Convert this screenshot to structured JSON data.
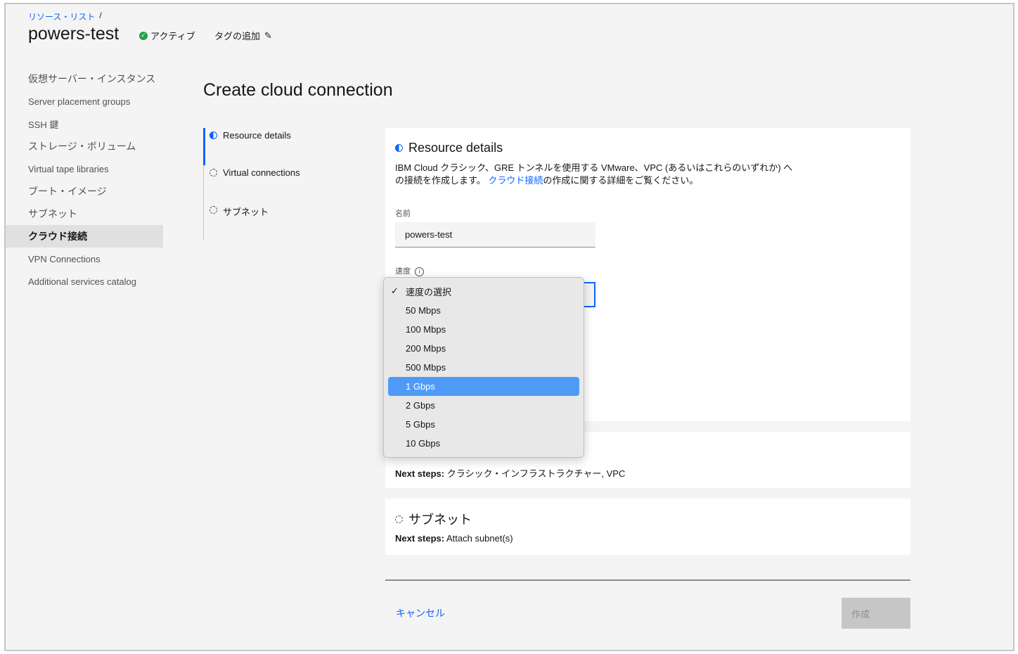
{
  "breadcrumb": {
    "link": "リソース・リスト",
    "separator": "/"
  },
  "header": {
    "title": "powers-test",
    "status": "アクティブ",
    "add_tag": "タグの追加"
  },
  "sidebar": {
    "items": [
      {
        "label": "仮想サーバー・インスタンス"
      },
      {
        "label": "Server placement groups"
      },
      {
        "label": "SSH 鍵"
      },
      {
        "label": "ストレージ・ボリューム"
      },
      {
        "label": "Virtual tape libraries"
      },
      {
        "label": "ブート・イメージ"
      },
      {
        "label": "サブネット"
      },
      {
        "label": "クラウド接続"
      },
      {
        "label": "VPN Connections"
      },
      {
        "label": "Additional services catalog"
      }
    ],
    "active_index": 7
  },
  "page": {
    "title": "Create cloud connection"
  },
  "steps": [
    {
      "label": "Resource details",
      "state": "in-progress"
    },
    {
      "label": "Virtual connections",
      "state": "not-started"
    },
    {
      "label": "サブネット",
      "state": "not-started"
    }
  ],
  "resource_details": {
    "title": "Resource details",
    "description_part1": "IBM Cloud クラシック、GRE トンネルを使用する VMware、VPC (あるいはこれらのいずれか) への接続を作成します。",
    "description_link": "クラウド接続",
    "description_part2": "の作成に関する詳細をご覧ください。",
    "name_label": "名前",
    "name_value": "powers-test",
    "speed_label": "速度"
  },
  "speed_dropdown": {
    "options": [
      "速度の選択",
      "50 Mbps",
      "100 Mbps",
      "200 Mbps",
      "500 Mbps",
      "1 Gbps",
      "2 Gbps",
      "5 Gbps",
      "10 Gbps"
    ],
    "checked": "速度の選択",
    "highlighted": "1 Gbps"
  },
  "virtual_connections": {
    "next_steps_label": "Next steps:",
    "next_steps_value": "クラシック・インフラストラクチャー, VPC"
  },
  "subnet": {
    "title": "サブネット",
    "next_steps_label": "Next steps:",
    "next_steps_value": "Attach subnet(s)"
  },
  "footer": {
    "cancel": "キャンセル",
    "create": "作成"
  },
  "colors": {
    "accent": "#0f62fe",
    "status_green": "#24a148",
    "highlight": "#4e9bf7"
  }
}
